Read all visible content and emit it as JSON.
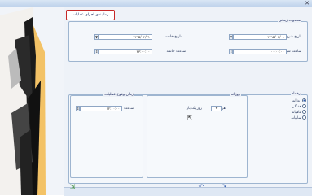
{
  "window": {
    "close_glyph": "✕"
  },
  "tab": {
    "label": "زمانبندی اجرای عملیات"
  },
  "section_time": {
    "title": "محدوده زمانی",
    "start_date_label": "تاریخ شروع",
    "start_date_value": "۱۳۹۵/۰۶/۰۱",
    "end_date_label": "تاریخ خاتمه",
    "end_date_value": "۱۳۹۵/۰۶/۳۱",
    "start_time_label": "ساعت شروع",
    "start_time_value": "۰۰:۰۰:۰۰",
    "end_time_label": "ساعت خاتمه",
    "end_time_value": "۲۳:۰۰:۰۰"
  },
  "repeat": {
    "title": "رخداد",
    "options": [
      {
        "label": "روزانه",
        "selected": true
      },
      {
        "label": "هفتگی",
        "selected": false
      },
      {
        "label": "ماهیانه",
        "selected": false
      },
      {
        "label": "سالیانه",
        "selected": false
      }
    ]
  },
  "daily": {
    "title": "روزانه",
    "every_label": "هر",
    "every_value": "۲",
    "days_label": "روز یک بار"
  },
  "occurrence": {
    "title": "زمان وقوع عملیات",
    "time_label": "ساعت",
    "time_value": "۱۲:۰۰:۰۰"
  },
  "footer": {
    "exit_icon": "exit-icon",
    "undo_icon": "undo-icon",
    "redo_icon": "redo-icon"
  }
}
